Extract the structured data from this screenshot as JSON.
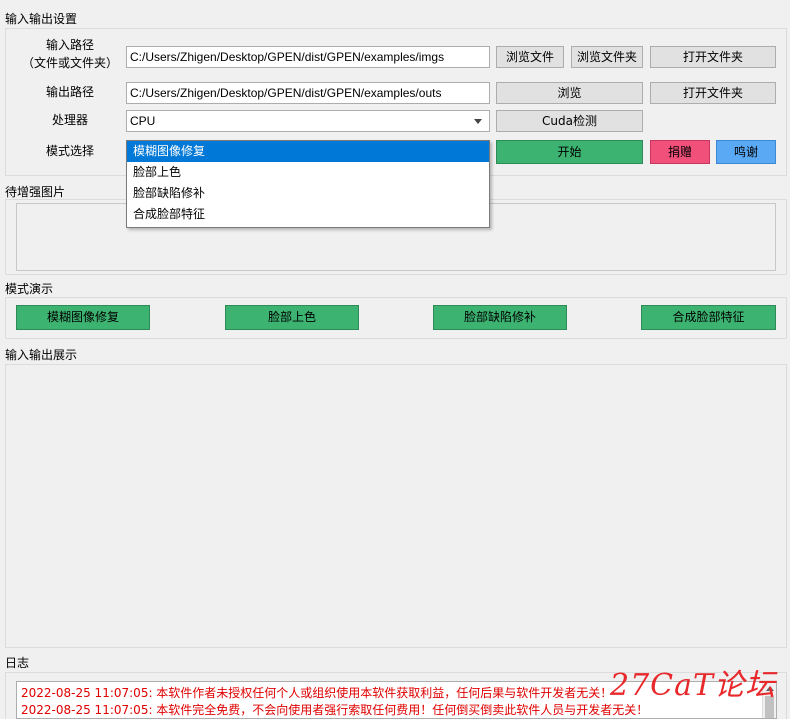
{
  "sections": {
    "io_settings": "输入输出设置",
    "pending_images": "待增强图片",
    "mode_demo": "模式演示",
    "io_display": "输入输出展示",
    "log": "日志"
  },
  "io": {
    "input_label_line1": "输入路径",
    "input_label_line2": "（文件或文件夹）",
    "input_path": "C:/Users/Zhigen/Desktop/GPEN/dist/GPEN/examples/imgs",
    "browse_file": "浏览文件",
    "browse_folder": "浏览文件夹",
    "open_folder_1": "打开文件夹",
    "output_label": "输出路径",
    "output_path": "C:/Users/Zhigen/Desktop/GPEN/dist/GPEN/examples/outs",
    "browse": "浏览",
    "open_folder_2": "打开文件夹",
    "processor_label": "处理器",
    "processor_value": "CPU",
    "cuda_check": "Cuda检测",
    "mode_label": "模式选择",
    "start": "开始",
    "donate": "捐赠",
    "thanks": "鸣谢"
  },
  "mode_options": [
    "模糊图像修复",
    "脸部上色",
    "脸部缺陷修补",
    "合成脸部特征"
  ],
  "demo_buttons": [
    "模糊图像修复",
    "脸部上色",
    "脸部缺陷修补",
    "合成脸部特征"
  ],
  "log_lines": [
    "2022-08-25 11:07:05: 本软件作者未授权任何个人或组织使用本软件获取利益，任何后果与软件开发者无关！",
    "2022-08-25 11:07:05: 本软件完全免费，不会向使用者强行索取任何费用！任何倒买倒卖此软件人员与开发者无关！"
  ],
  "watermark": "27CaT论坛",
  "colors": {
    "start_green": "#3cb371",
    "donate_pink": "#f0507a",
    "thanks_blue": "#5aa9f5",
    "selection_blue": "#0078d7",
    "log_red": "#e00000",
    "watermark_red": "#e8282b"
  }
}
